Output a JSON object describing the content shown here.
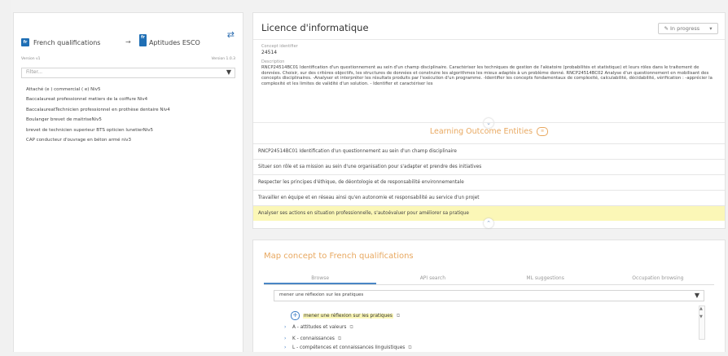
{
  "left_panel": {
    "source_lang": "French qualifications",
    "source_flag": "fr",
    "target_lang": "Aptitudes ESCO",
    "target_flag": "fr",
    "arrow": "→",
    "swap_icon": "⇄",
    "version_left": "Version v1",
    "version_right": "Version 1.0.3",
    "filter_placeholder": "Filter...",
    "qualifications": [
      "Attaché (e ) commercial ( e) Niv5",
      "Baccalaureat professionnel metiers de la coiffure Niv4",
      "BaccalaureatTechnicien professionnel en prothèse dentaire Niv4",
      "Boulanger brevet de maitriseNiv5",
      "brevet de technicien superieur BTS opticien lunetierNiv5",
      "CAP conducteur d'ouvrage en béton armé niv3"
    ]
  },
  "concept": {
    "title": "Licence d'informatique",
    "status": "In progress",
    "status_icon": "✎",
    "dropdown_icon": "▾",
    "identifier_label": "Concept identifier",
    "identifier": "24514",
    "description_label": "Description",
    "description": "RNCP24514BC01 Identification d'un questionnement au sein d'un champ disciplinaire. Caractériser les techniques de gestion de l'aléatoire (probabilités et statistique) et leurs rôles dans le traitement de données. Choisir, sur des critères objectifs, les structures de données et construire les algorithmes les mieux adaptés à un problème donné. RNCP24514BC02 Analyse d'un questionnement en mobilisant des concepts disciplinaires. -Analyser et interpréter les résultats produits par l'exécution d'un programme. -Identifier les concepts fondamentaux de complexité, calculabilité, décidabilité, vérification : -apprécier la complexité et les limites de validité d'un solution. - Identifier et caractériser les",
    "expand_icon": "⌄",
    "collapse_icon": "⌃"
  },
  "learning_outcomes": {
    "title": "Learning Outcome Entities",
    "badge": "≡",
    "items": [
      "RNCP24514BC01 Identification d'un questionnement au sein d'un champ disciplinaire",
      "Situer son rôle et sa mission au sein d'une organisation pour s'adapter et prendre des initiatives",
      "Respecter les principes d'éthique, de déontologie et de responsabilité environnementale",
      "Travailler en équipe et en réseau ainsi qu'en autonomie et responsabilité au service d'un projet",
      "Analyser ses actions en situation professionnelle, s'autoévaluer pour améliorer sa pratique"
    ],
    "highlighted_index": 4,
    "highlight_color": "#fbf7b7"
  },
  "mapping": {
    "title": "Map concept to French qualifications",
    "tabs": [
      "Browse",
      "API search",
      "ML suggestions",
      "Occupation browsing"
    ],
    "active_tab": 0,
    "search_value": "mener une réflexion sur les pratiques",
    "filter_icon": "▼",
    "top_result": "mener une réflexion sur les pratiques",
    "tree": [
      "A - attitudes et valeurs",
      "K - connaissances",
      "L - compétences et connaissances linguistiques"
    ]
  },
  "colors": {
    "accent_orange": "#e8a860",
    "accent_blue": "#3b7dc4",
    "highlight_yellow": "#fbf7b7"
  }
}
